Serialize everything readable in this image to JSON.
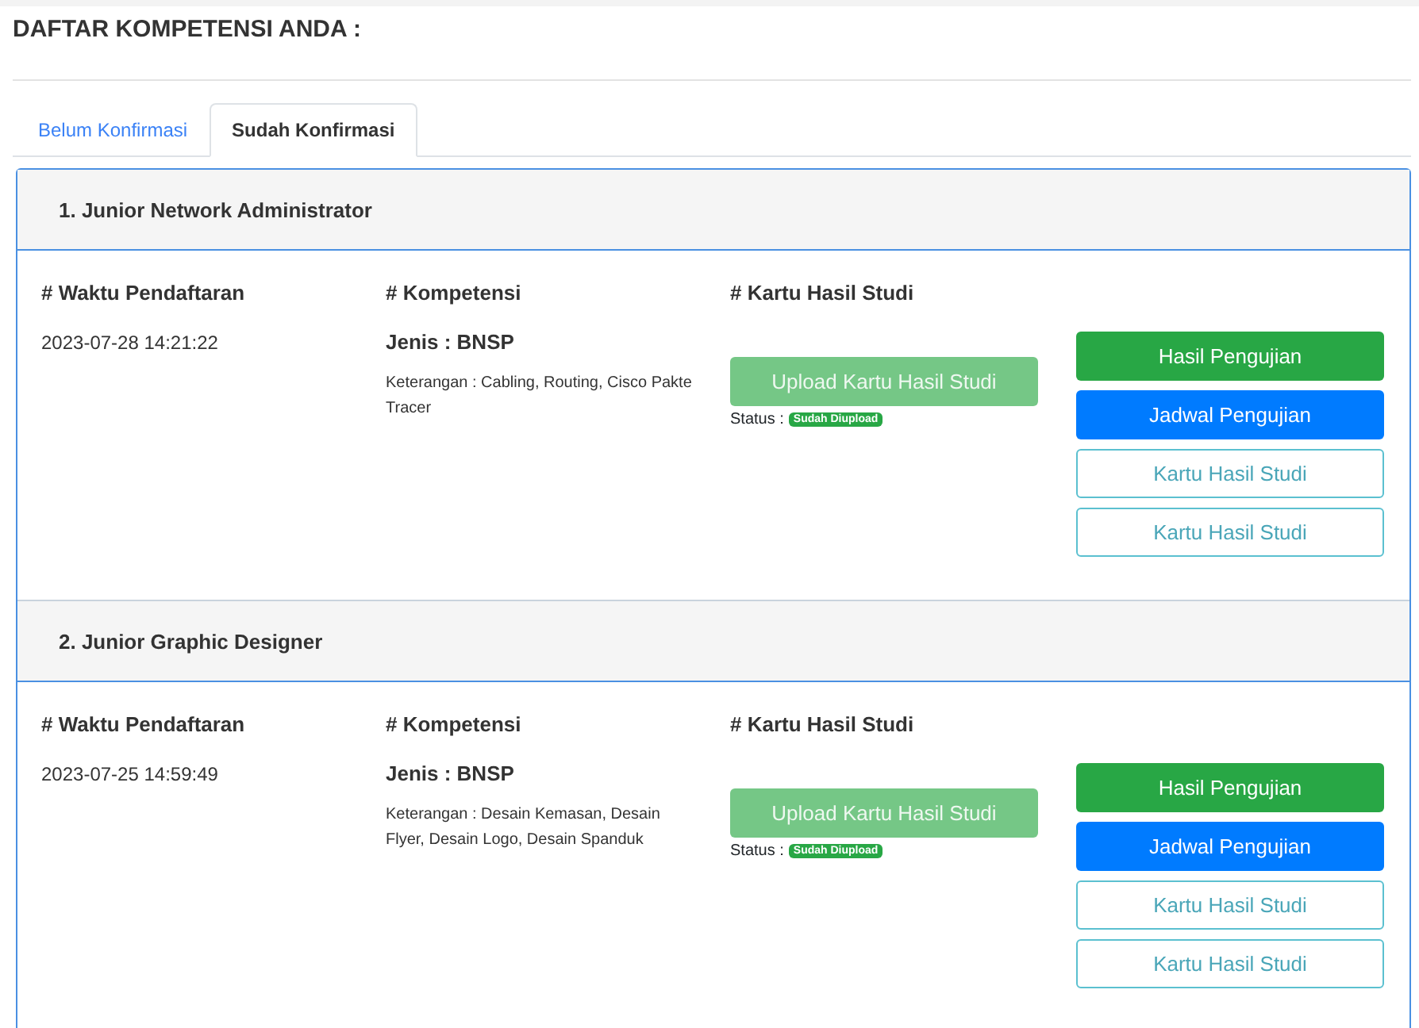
{
  "title": "DAFTAR KOMPETENSI ANDA :",
  "tabs": [
    {
      "label": "Belum Konfirmasi",
      "selected": false
    },
    {
      "label": "Sudah Konfirmasi",
      "selected": true
    }
  ],
  "competencies": [
    {
      "heading": "1. Junior Network Administrator",
      "col_time": "# Waktu Pendaftaran",
      "time": "2023-07-28 14:21:22",
      "col_comp": "# Kompetensi",
      "jenis": "Jenis : BNSP",
      "keterangan": "Keterangan : Cabling, Routing, Cisco Pakte Tracer",
      "col_khs": "# Kartu Hasil Studi",
      "upload": {
        "label": "Upload Kartu Hasil Studi",
        "disabled": true
      },
      "status_label": "Status :",
      "status_badge": "Sudah Diupload",
      "buttons": [
        {
          "label": "Hasil Pengujian",
          "kind": "success"
        },
        {
          "label": "Jadwal Pengujian",
          "kind": "primary"
        },
        {
          "label": "Kartu Hasil Studi",
          "kind": "outline"
        },
        {
          "label": "Kartu Hasil Studi",
          "kind": "outline"
        }
      ]
    },
    {
      "heading": "2. Junior Graphic Designer",
      "col_time": "# Waktu Pendaftaran",
      "time": "2023-07-25 14:59:49",
      "col_comp": "# Kompetensi",
      "jenis": "Jenis : BNSP",
      "keterangan": "Keterangan : Desain Kemasan, Desain Flyer, Desain Logo, Desain Spanduk",
      "col_khs": "# Kartu Hasil Studi",
      "upload": {
        "label": "Upload Kartu Hasil Studi",
        "disabled": true
      },
      "status_label": "Status :",
      "status_badge": "Sudah Diupload",
      "buttons": [
        {
          "label": "Hasil Pengujian",
          "kind": "success"
        },
        {
          "label": "Jadwal Pengujian",
          "kind": "primary"
        },
        {
          "label": "Kartu Hasil Studi",
          "kind": "outline"
        },
        {
          "label": "Kartu Hasil Studi",
          "kind": "outline"
        }
      ]
    }
  ]
}
